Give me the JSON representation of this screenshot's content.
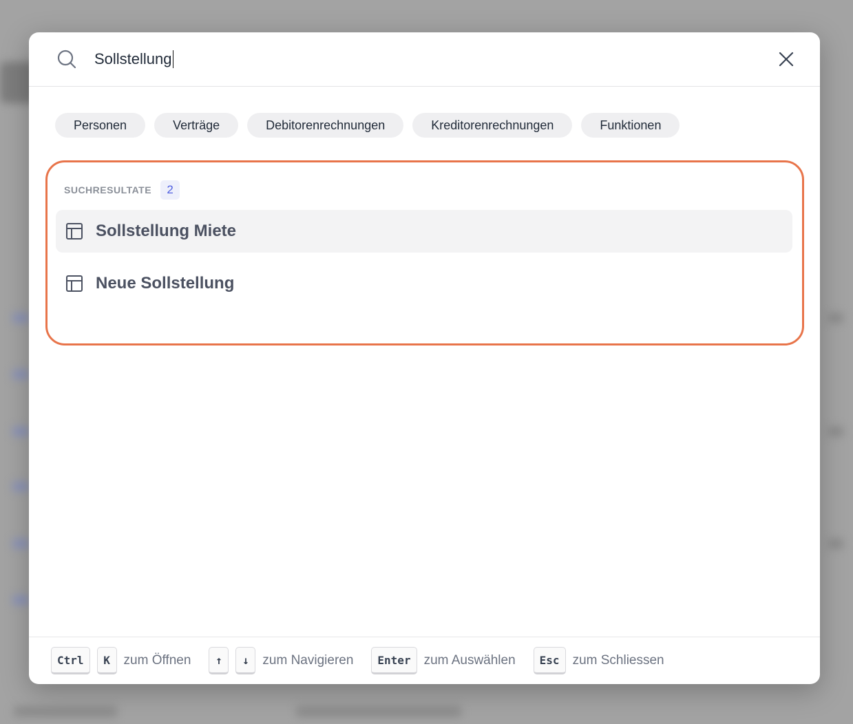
{
  "search": {
    "value": "Sollstellung"
  },
  "filters": [
    {
      "label": "Personen"
    },
    {
      "label": "Verträge"
    },
    {
      "label": "Debitorenrechnungen"
    },
    {
      "label": "Kreditorenrechnungen"
    },
    {
      "label": "Funktionen"
    }
  ],
  "results": {
    "heading": "SUCHRESULTATE",
    "count": "2",
    "items": [
      {
        "label": "Sollstellung Miete",
        "icon": "layout-icon"
      },
      {
        "label": "Neue Sollstellung",
        "icon": "layout-icon"
      }
    ]
  },
  "footer": {
    "shortcuts": [
      {
        "keys": [
          "Ctrl",
          "K"
        ],
        "text": "zum Öffnen"
      },
      {
        "keys": [
          "↑",
          "↓"
        ],
        "text": "zum Navigieren"
      },
      {
        "keys": [
          "Enter"
        ],
        "text": "zum Auswählen"
      },
      {
        "keys": [
          "Esc"
        ],
        "text": "zum Schliessen"
      }
    ]
  },
  "colors": {
    "highlight_border": "#e8744a",
    "count_badge_text": "#4f5fe0"
  }
}
